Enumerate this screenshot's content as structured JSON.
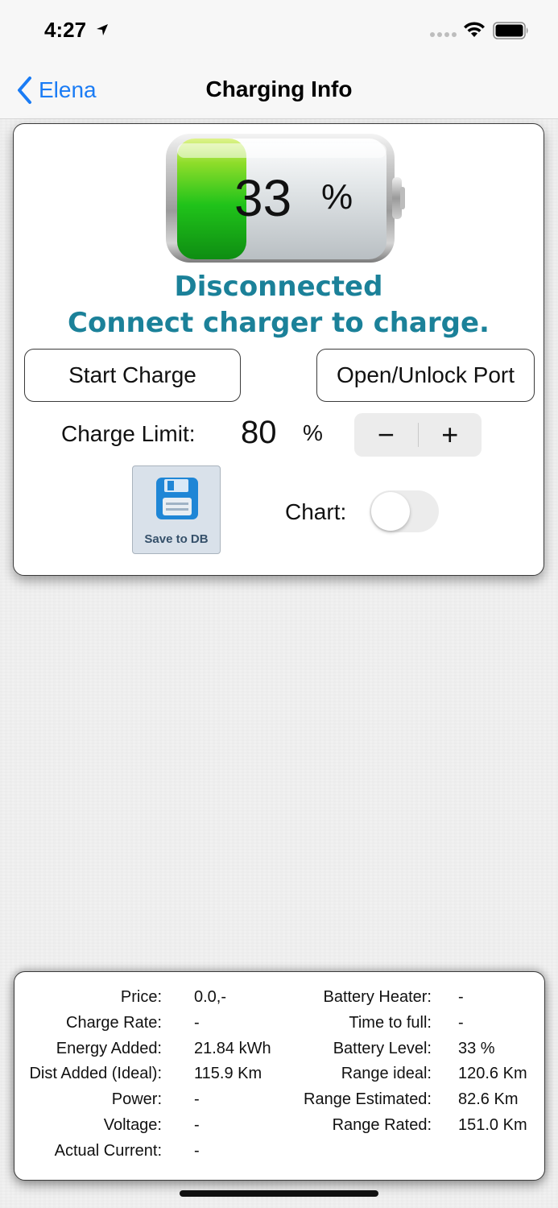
{
  "status_bar": {
    "time": "4:27"
  },
  "nav": {
    "back_label": "Elena",
    "title": "Charging Info"
  },
  "battery": {
    "percent": "33",
    "percent_sign": "%",
    "level": 0.33
  },
  "status": {
    "line1": "Disconnected",
    "line2": "Connect charger to charge."
  },
  "buttons": {
    "start_charge": "Start Charge",
    "open_port": "Open/Unlock Port",
    "save_db": "Save to DB"
  },
  "charge_limit": {
    "label": "Charge Limit:",
    "value": "80",
    "unit": "%",
    "minus": "−",
    "plus": "+"
  },
  "chart_toggle": {
    "label": "Chart:",
    "on": false
  },
  "info_left": [
    {
      "label": "Price:",
      "value": "0.0,-"
    },
    {
      "label": "Charge Rate:",
      "value": "-"
    },
    {
      "label": "Energy Added:",
      "value": "21.84 kWh"
    },
    {
      "label": "Dist Added (Ideal):",
      "value": "115.9 Km"
    },
    {
      "label": "Power:",
      "value": "-"
    },
    {
      "label": "Voltage:",
      "value": "-"
    },
    {
      "label": "Actual Current:",
      "value": "-"
    }
  ],
  "info_right": [
    {
      "label": "Battery Heater:",
      "value": "-"
    },
    {
      "label": "Time to full:",
      "value": "-"
    },
    {
      "label": "Battery Level:",
      "value": "33 %"
    },
    {
      "label": "Range ideal:",
      "value": "120.6 Km"
    },
    {
      "label": "Range  Estimated:",
      "value": "82.6 Km"
    },
    {
      "label": "Range Rated:",
      "value": "151.0 Km"
    }
  ],
  "colors": {
    "accent": "#1a7cf5",
    "status_text": "#1b8199",
    "battery_green": "#22c01e"
  }
}
